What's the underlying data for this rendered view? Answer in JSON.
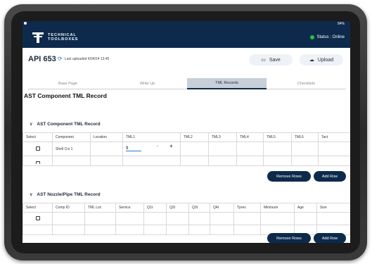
{
  "statusbar": {
    "battery": "84%"
  },
  "app": {
    "brand_line1": "TECHNICAL",
    "brand_line2": "TOOLBOXES",
    "status": "Status : Online"
  },
  "header": {
    "title": "API 653",
    "last_uploaded": "Last uploaded 6/04/24 13:45",
    "save_label": "Save",
    "upload_label": "Upload"
  },
  "tabs": [
    {
      "label": "Base Page",
      "active": false
    },
    {
      "label": "Write Up",
      "active": false
    },
    {
      "label": "TML Records",
      "active": true
    },
    {
      "label": "Checklists",
      "active": false
    }
  ],
  "page_title": "AST Component TML Record",
  "component_section": {
    "title": "AST Component TML Record",
    "columns": [
      "Select",
      "Component",
      "Location",
      "TML1",
      "TML2",
      "TML3",
      "TML4",
      "TML5",
      "TML6",
      "Tact"
    ],
    "rows": [
      {
        "component": "Shell Crs 1",
        "location": "",
        "tml1": "9"
      }
    ],
    "remove_label": "Remove Rows",
    "add_label": "Add Row"
  },
  "nozzle_section": {
    "title": "AST Nozzle/Pipe TML Record",
    "columns": [
      "Select",
      "Comp ID",
      "TML Loc",
      "Service",
      "Q1t",
      "Q2t",
      "Q3t",
      "Q4t",
      "Tprev",
      "Minimum",
      "Age",
      "Size"
    ],
    "remove_label": "Remove Rows",
    "add_label": "Add Row"
  },
  "colors": {
    "navy": "#0d2a4d",
    "online_green": "#2fbf3b",
    "accent_blue": "#2a7ac9"
  }
}
